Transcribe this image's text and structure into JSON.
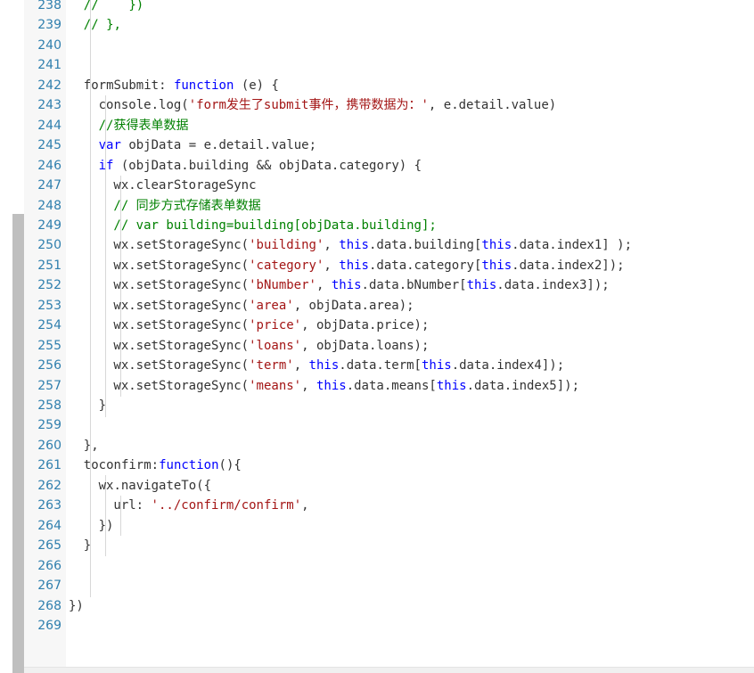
{
  "editor": {
    "lines": [
      {
        "n": "238",
        "indent": 1,
        "t": [
          [
            "cm",
            "//    })"
          ]
        ]
      },
      {
        "n": "239",
        "indent": 1,
        "t": [
          [
            "cm",
            "// },"
          ]
        ]
      },
      {
        "n": "240",
        "indent": 0,
        "t": []
      },
      {
        "n": "241",
        "indent": 0,
        "t": []
      },
      {
        "n": "242",
        "indent": 1,
        "t": [
          [
            "p",
            "formSubmit: "
          ],
          [
            "kw",
            "function"
          ],
          [
            "p",
            " (e) {"
          ]
        ]
      },
      {
        "n": "243",
        "indent": 2,
        "t": [
          [
            "p",
            "console.log("
          ],
          [
            "str",
            "'form发生了submit事件，携带数据为：'"
          ],
          [
            "p",
            ", e.detail.value)"
          ]
        ]
      },
      {
        "n": "244",
        "indent": 2,
        "t": [
          [
            "cm",
            "//获得表单数据"
          ]
        ]
      },
      {
        "n": "245",
        "indent": 2,
        "t": [
          [
            "kw",
            "var"
          ],
          [
            "p",
            " objData = e.detail.value;"
          ]
        ]
      },
      {
        "n": "246",
        "indent": 2,
        "t": [
          [
            "kw",
            "if"
          ],
          [
            "p",
            " (objData.building && objData.category) {"
          ]
        ]
      },
      {
        "n": "247",
        "indent": 3,
        "t": [
          [
            "p",
            "wx.clearStorageSync"
          ]
        ]
      },
      {
        "n": "248",
        "indent": 3,
        "t": [
          [
            "cm",
            "// 同步方式存储表单数据"
          ]
        ]
      },
      {
        "n": "249",
        "indent": 3,
        "t": [
          [
            "cm",
            "// var building=building[objData.building];"
          ]
        ]
      },
      {
        "n": "250",
        "indent": 3,
        "t": [
          [
            "p",
            "wx.setStorageSync("
          ],
          [
            "str",
            "'building'"
          ],
          [
            "p",
            ", "
          ],
          [
            "kw",
            "this"
          ],
          [
            "p",
            ".data.building["
          ],
          [
            "kw",
            "this"
          ],
          [
            "p",
            ".data.index1] );"
          ]
        ]
      },
      {
        "n": "251",
        "indent": 3,
        "t": [
          [
            "p",
            "wx.setStorageSync("
          ],
          [
            "str",
            "'category'"
          ],
          [
            "p",
            ", "
          ],
          [
            "kw",
            "this"
          ],
          [
            "p",
            ".data.category["
          ],
          [
            "kw",
            "this"
          ],
          [
            "p",
            ".data.index2]);"
          ]
        ]
      },
      {
        "n": "252",
        "indent": 3,
        "t": [
          [
            "p",
            "wx.setStorageSync("
          ],
          [
            "str",
            "'bNumber'"
          ],
          [
            "p",
            ", "
          ],
          [
            "kw",
            "this"
          ],
          [
            "p",
            ".data.bNumber["
          ],
          [
            "kw",
            "this"
          ],
          [
            "p",
            ".data.index3]);"
          ]
        ]
      },
      {
        "n": "253",
        "indent": 3,
        "t": [
          [
            "p",
            "wx.setStorageSync("
          ],
          [
            "str",
            "'area'"
          ],
          [
            "p",
            ", objData.area);"
          ]
        ]
      },
      {
        "n": "254",
        "indent": 3,
        "t": [
          [
            "p",
            "wx.setStorageSync("
          ],
          [
            "str",
            "'price'"
          ],
          [
            "p",
            ", objData.price);"
          ]
        ]
      },
      {
        "n": "255",
        "indent": 3,
        "t": [
          [
            "p",
            "wx.setStorageSync("
          ],
          [
            "str",
            "'loans'"
          ],
          [
            "p",
            ", objData.loans);"
          ]
        ]
      },
      {
        "n": "256",
        "indent": 3,
        "t": [
          [
            "p",
            "wx.setStorageSync("
          ],
          [
            "str",
            "'term'"
          ],
          [
            "p",
            ", "
          ],
          [
            "kw",
            "this"
          ],
          [
            "p",
            ".data.term["
          ],
          [
            "kw",
            "this"
          ],
          [
            "p",
            ".data.index4]);"
          ]
        ]
      },
      {
        "n": "257",
        "indent": 3,
        "t": [
          [
            "p",
            "wx.setStorageSync("
          ],
          [
            "str",
            "'means'"
          ],
          [
            "p",
            ", "
          ],
          [
            "kw",
            "this"
          ],
          [
            "p",
            ".data.means["
          ],
          [
            "kw",
            "this"
          ],
          [
            "p",
            ".data.index5]);"
          ]
        ]
      },
      {
        "n": "258",
        "indent": 2,
        "t": [
          [
            "p",
            "}"
          ]
        ]
      },
      {
        "n": "259",
        "indent": 0,
        "t": []
      },
      {
        "n": "260",
        "indent": 1,
        "t": [
          [
            "p",
            "},"
          ]
        ]
      },
      {
        "n": "261",
        "indent": 1,
        "t": [
          [
            "p",
            "toconfirm:"
          ],
          [
            "kw",
            "function"
          ],
          [
            "p",
            "(){"
          ]
        ]
      },
      {
        "n": "262",
        "indent": 2,
        "t": [
          [
            "p",
            "wx.navigateTo({"
          ]
        ]
      },
      {
        "n": "263",
        "indent": 3,
        "t": [
          [
            "p",
            "url: "
          ],
          [
            "str",
            "'../confirm/confirm'"
          ],
          [
            "p",
            ","
          ]
        ]
      },
      {
        "n": "264",
        "indent": 2,
        "t": [
          [
            "p",
            "})"
          ]
        ]
      },
      {
        "n": "265",
        "indent": 1,
        "t": [
          [
            "p",
            "}"
          ]
        ]
      },
      {
        "n": "266",
        "indent": 0,
        "t": []
      },
      {
        "n": "267",
        "indent": 0,
        "t": []
      },
      {
        "n": "268",
        "indent": 0,
        "t": [
          [
            "p",
            "})"
          ]
        ]
      },
      {
        "n": "269",
        "indent": 0,
        "t": []
      }
    ]
  },
  "colors": {
    "keyword": "#0000ff",
    "string": "#a31515",
    "comment": "#008000",
    "plain": "#333333",
    "line_number": "#2f7fae"
  }
}
